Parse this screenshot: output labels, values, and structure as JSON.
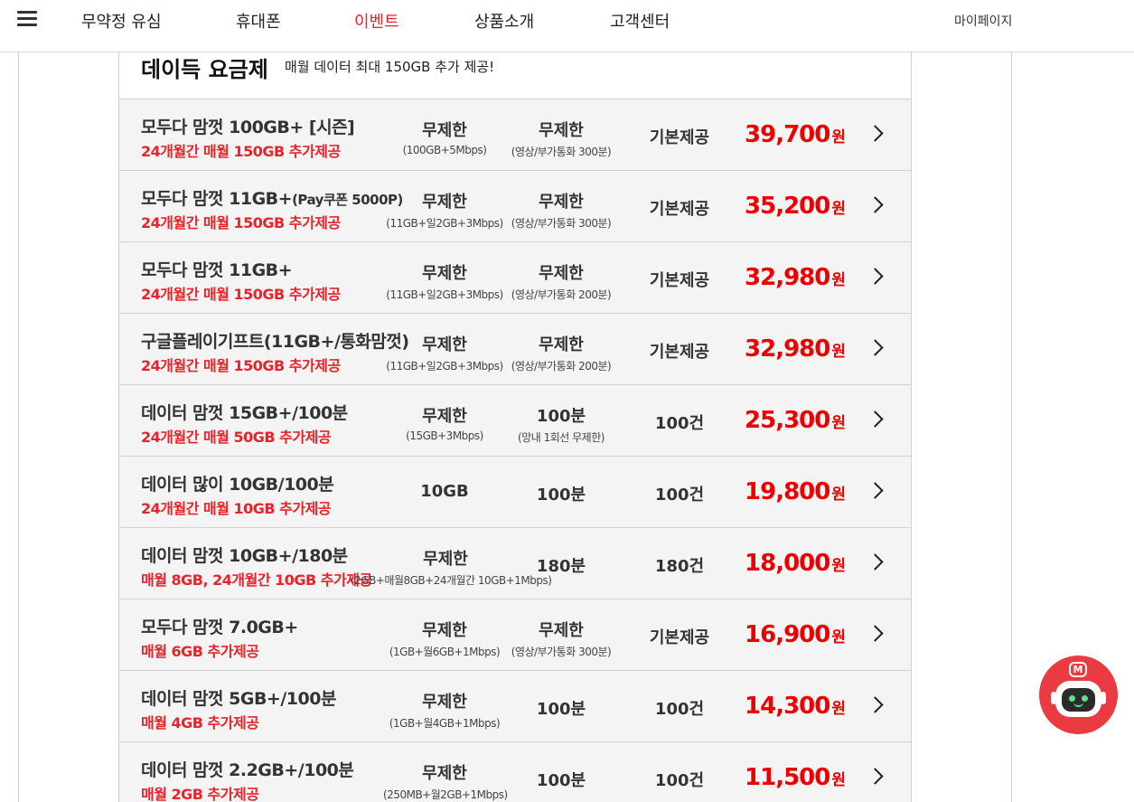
{
  "nav": {
    "items": [
      {
        "label": "무약정 유심",
        "active": false
      },
      {
        "label": "휴대폰",
        "active": false
      },
      {
        "label": "이벤트",
        "active": true
      },
      {
        "label": "상품소개",
        "active": false
      },
      {
        "label": "고객센터",
        "active": false
      }
    ],
    "mypage": "마이페이지"
  },
  "section": {
    "title": "데이득 요금제",
    "subtitle": "매월 데이터 최대 150GB 추가 제공!"
  },
  "plans": [
    {
      "name": "모두다 맘껏 100GB+ [시즌]",
      "name_sub": "",
      "bonus": "24개월간 매월 150GB 추가제공",
      "data": "무제한",
      "data_note": "(100GB+5Mbps)",
      "voice": "무제한",
      "voice_note": "(영상/부가통화 300분)",
      "sms": "기본제공",
      "price": "39,700",
      "unit": "원"
    },
    {
      "name": "모두다 맘껏 11GB+",
      "name_sub": "(Pay쿠폰 5000P)",
      "bonus": "24개월간 매월 150GB 추가제공",
      "data": "무제한",
      "data_note": "(11GB+일2GB+3Mbps)",
      "voice": "무제한",
      "voice_note": "(영상/부가통화 300분)",
      "sms": "기본제공",
      "price": "35,200",
      "unit": "원"
    },
    {
      "name": "모두다 맘껏 11GB+",
      "name_sub": "",
      "bonus": "24개월간 매월 150GB 추가제공",
      "data": "무제한",
      "data_note": "(11GB+일2GB+3Mbps)",
      "voice": "무제한",
      "voice_note": "(영상/부가통화 200분)",
      "sms": "기본제공",
      "price": "32,980",
      "unit": "원"
    },
    {
      "name": "구글플레이기프트(11GB+/통화맘껏)",
      "name_sub": "",
      "bonus": "24개월간 매월 150GB 추가제공",
      "data": "무제한",
      "data_note": "(11GB+일2GB+3Mbps)",
      "voice": "무제한",
      "voice_note": "(영상/부가통화 200분)",
      "sms": "기본제공",
      "price": "32,980",
      "unit": "원"
    },
    {
      "name": "데이터 맘껏 15GB+/100분",
      "name_sub": "",
      "bonus": "24개월간 매월 50GB 추가제공",
      "data": "무제한",
      "data_note": "(15GB+3Mbps)",
      "voice": "100분",
      "voice_note": "(망내 1회선 무제한)",
      "sms": "100건",
      "price": "25,300",
      "unit": "원"
    },
    {
      "name": "데이터 많이 10GB/100분",
      "name_sub": "",
      "bonus": "24개월간 매월 10GB 추가제공",
      "data": "10GB",
      "data_note": "",
      "voice": "100분",
      "voice_note": "",
      "sms": "100건",
      "price": "19,800",
      "unit": "원"
    },
    {
      "name": "데이터 맘껏 10GB+/180분",
      "name_sub": "",
      "bonus": "매월 8GB, 24개월간 10GB 추가제공",
      "data": "무제한",
      "data_note": "(2GB+매월8GB+24개월간 10GB+1Mbps)",
      "voice": "180분",
      "voice_note": "",
      "sms": "180건",
      "price": "18,000",
      "unit": "원"
    },
    {
      "name": "모두다 맘껏 7.0GB+",
      "name_sub": "",
      "bonus": "매월 6GB 추가제공",
      "data": "무제한",
      "data_note": "(1GB+월6GB+1Mbps)",
      "voice": "무제한",
      "voice_note": "(영상/부가통화 300분)",
      "sms": "기본제공",
      "price": "16,900",
      "unit": "원"
    },
    {
      "name": "데이터 맘껏 5GB+/100분",
      "name_sub": "",
      "bonus": "매월 4GB 추가제공",
      "data": "무제한",
      "data_note": "(1GB+월4GB+1Mbps)",
      "voice": "100분",
      "voice_note": "",
      "sms": "100건",
      "price": "14,300",
      "unit": "원"
    },
    {
      "name": "데이터 맘껏 2.2GB+/100분",
      "name_sub": "",
      "bonus": "매월 2GB 추가제공",
      "data": "무제한",
      "data_note": "(250MB+월2GB+1Mbps)",
      "voice": "100분",
      "voice_note": "",
      "sms": "100건",
      "price": "11,500",
      "unit": "원"
    }
  ],
  "chatbot": {
    "badge": "M"
  },
  "colors": {
    "accent": "#e8232a",
    "price": "#ee0000",
    "row_bg": "#f4f4f4",
    "chatbot": "#ea3b43"
  }
}
